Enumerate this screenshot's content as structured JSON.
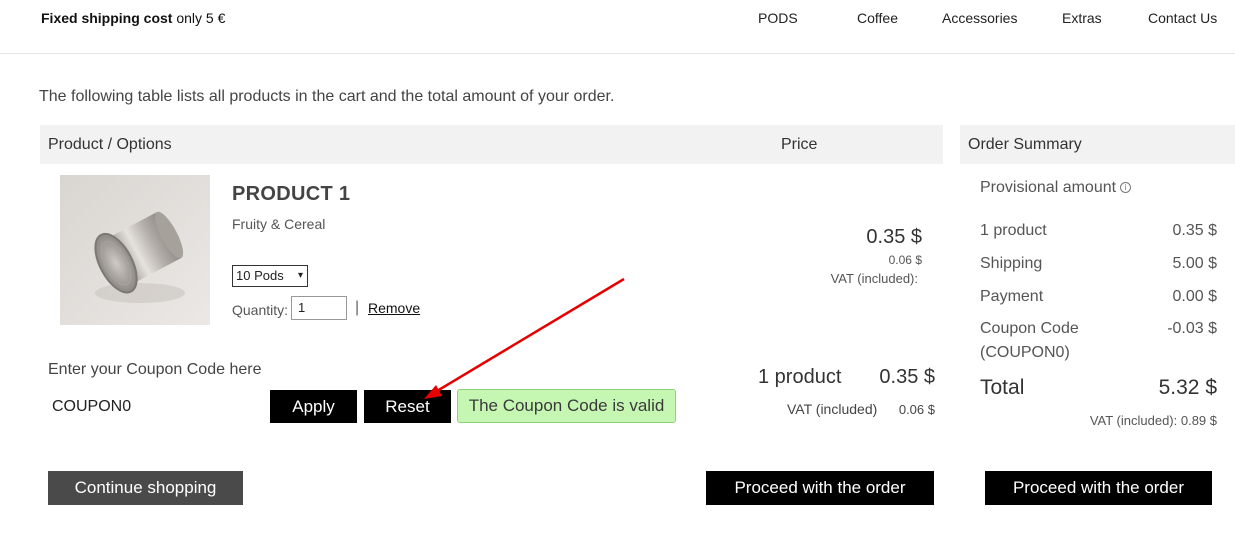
{
  "header": {
    "promo_bold": "Fixed shipping cost",
    "promo_rest": " only 5 €",
    "nav": [
      "PODS",
      "Coffee",
      "Accessories",
      "Extras",
      "Contact Us"
    ]
  },
  "intro_text": "The following table lists all products in the cart and the total amount of your order.",
  "table": {
    "col_product": "Product / Options",
    "col_price": "Price"
  },
  "product": {
    "name": "PRODUCT 1",
    "subtitle": "Fruity & Cereal",
    "variant": "10 Pods",
    "quantity_label": "Quantity:",
    "quantity": "1",
    "separator": "|",
    "remove_label": "Remove",
    "price": "0.35 $",
    "vat_value": "0.06 $",
    "vat_label": "VAT (included):"
  },
  "coupon": {
    "label": "Enter your Coupon Code here",
    "value": "COUPON0",
    "apply_label": "Apply",
    "reset_label": "Reset",
    "status": "The Coupon Code is valid",
    "status_color": "#c6f7b2"
  },
  "cart_totals": {
    "count": "1 product",
    "total": "0.35 $",
    "vat_label": "VAT (included)",
    "vat_value": "0.06 $"
  },
  "summary": {
    "title": "Order Summary",
    "provisional": "Provisional amount",
    "rows": [
      {
        "label": "1 product",
        "value": "0.35 $"
      },
      {
        "label": "Shipping",
        "value": "5.00 $"
      },
      {
        "label": "Payment",
        "value": "0.00 $"
      },
      {
        "label": "Coupon Code",
        "label2": "(COUPON0)",
        "value": "-0.03 $"
      }
    ],
    "total_label": "Total",
    "total_value": "5.32 $",
    "vat_text": "VAT (included): 0.89 $"
  },
  "buttons": {
    "continue": "Continue shopping",
    "proceed": "Proceed with the order"
  },
  "colors": {
    "annotation_arrow": "#e60000",
    "button_dark": "#000000",
    "button_gray": "#4a4a4a"
  }
}
